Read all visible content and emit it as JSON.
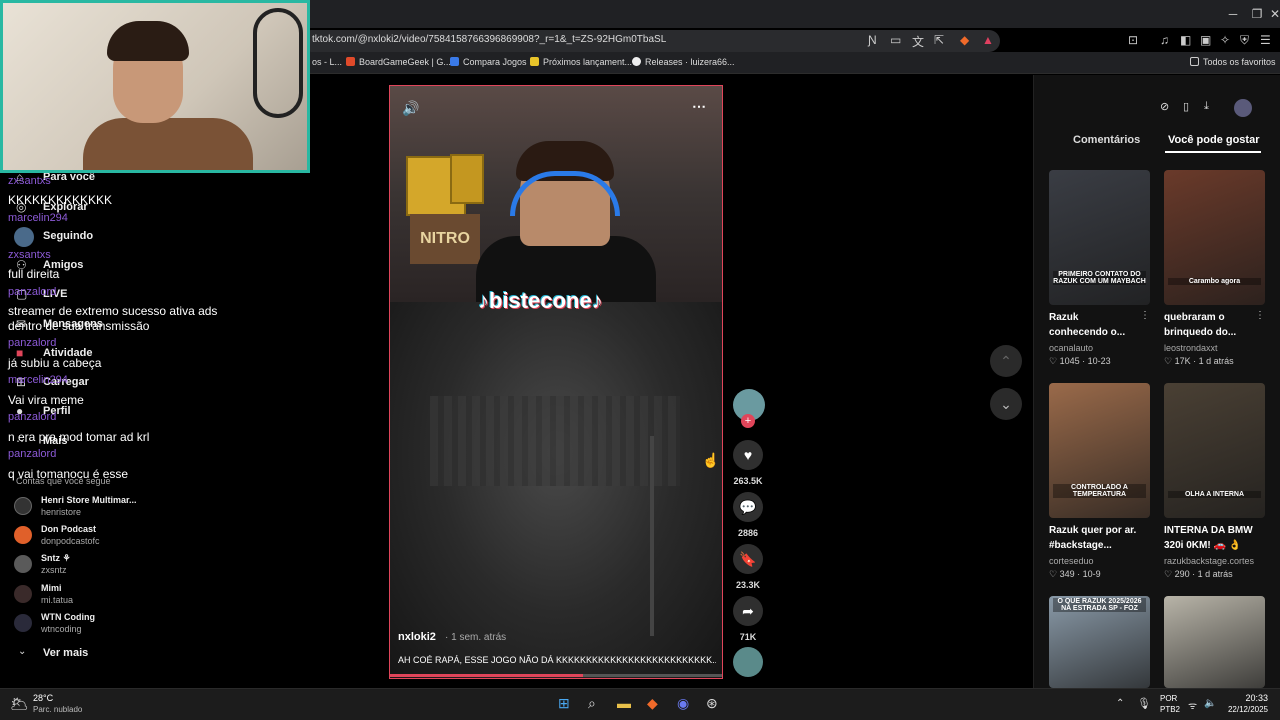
{
  "browser": {
    "url": "tktok.com/@nxloki2/video/7584158766396869908?_r=1&_t=ZS-92HGm0TbaSL",
    "bookmarks": [
      "os - L...",
      "BoardGameGeek | G...",
      "Compara Jogos",
      "Próximos lançament...",
      "Releases · luizera66...",
      "Todos os favoritos"
    ]
  },
  "sidebar": {
    "items": [
      "Para você",
      "Explorar",
      "Seguindo",
      "Amigos",
      "LIVE",
      "Mensagens",
      "Atividade",
      "Carregar",
      "Perfil",
      "Mais"
    ],
    "following_header": "Contas que você segue",
    "following": [
      {
        "name": "Henri Store Multimar...",
        "handle": "henristore"
      },
      {
        "name": "Don Podcast",
        "handle": "donpodcastofc"
      },
      {
        "name": "Sntz ⚘",
        "handle": "zxsntz"
      },
      {
        "name": "Mimi",
        "handle": "mi.tatua"
      },
      {
        "name": "WTN Coding",
        "handle": "wtncoding"
      }
    ],
    "see_more": "Ver mais"
  },
  "chat": [
    {
      "user": "zxsantxs",
      "msg": "KKKKKKKKKKKKK"
    },
    {
      "user": "marcelin294",
      "msg": ""
    },
    {
      "user": "zxsantxs",
      "msg": "full direita"
    },
    {
      "user": "panzalord",
      "msg": "streamer de extremo sucesso ativa ads"
    },
    {
      "user": "",
      "msg": "dentro de sua transmissão"
    },
    {
      "user": "panzalord",
      "msg": "já subiu a cabeça"
    },
    {
      "user": "marcelin294",
      "msg": "Vai vira meme"
    },
    {
      "user": "panzalord",
      "msg": "n era pra mod tomar ad krl"
    },
    {
      "user": "panzalord",
      "msg": "q vai tomanocu é esse"
    }
  ],
  "video": {
    "watermark": "♪bisteconе♪",
    "author": "nxloki2",
    "time": "· 1 sem. atrás",
    "caption": "AH COÉ RAPÁ, ESSE JOGO NÃO DÁ KKKKKKKKKKKKKKKKKKKKKKKKKK...",
    "progress": 0.58,
    "likes": "263.5K",
    "comments": "2886",
    "saves": "23.3K",
    "shares": "71K"
  },
  "right_panel": {
    "tabs": [
      "Comentários",
      "Você pode gostar"
    ],
    "active_tab": 1,
    "videos": [
      {
        "title1": "Razuk",
        "title2": "conhecendo o...",
        "author": "ocanalauto",
        "meta": "♡ 1045 · 10-23",
        "caption": "PRIMEIRO CONTATO DO RAZUK COM UM MAYBACH",
        "color": "#3a3d44"
      },
      {
        "title1": "quebraram o",
        "title2": "brinquedo do...",
        "author": "leostrondaxxt",
        "meta": "♡ 17K · 1 d atrás",
        "caption": "Carambo agora",
        "color": "#6a3a2a"
      },
      {
        "title1": "Razuk quer por ar.",
        "title2": "#backstage...",
        "author": "corteseduo",
        "meta": "♡ 349 · 10-9",
        "caption": "CONTROLADO A TEMPERATURA",
        "color": "#9a6a4a"
      },
      {
        "title1": "INTERNA DA BMW",
        "title2": "320i 0KM! 🚗 👌",
        "author": "razukbackstage.cortes",
        "meta": "♡ 290 · 1 d atrás",
        "caption": "OLHA A INTERNA",
        "color": "#4a4034"
      },
      {
        "title1": "",
        "title2": "",
        "author": "",
        "meta": "",
        "caption": "O QUE RAZUK 2025/2026 NA ESTRADA SP - FOZ",
        "color": "#8a9aa8"
      },
      {
        "title1": "",
        "title2": "",
        "author": "",
        "meta": "",
        "caption": "",
        "color": "#b8b4a8"
      }
    ]
  },
  "taskbar": {
    "temp": "28°C",
    "weather": "Parc. nublado",
    "lang1": "POR",
    "lang2": "PTB2",
    "time": "20:33",
    "date": "22/12/2025"
  }
}
